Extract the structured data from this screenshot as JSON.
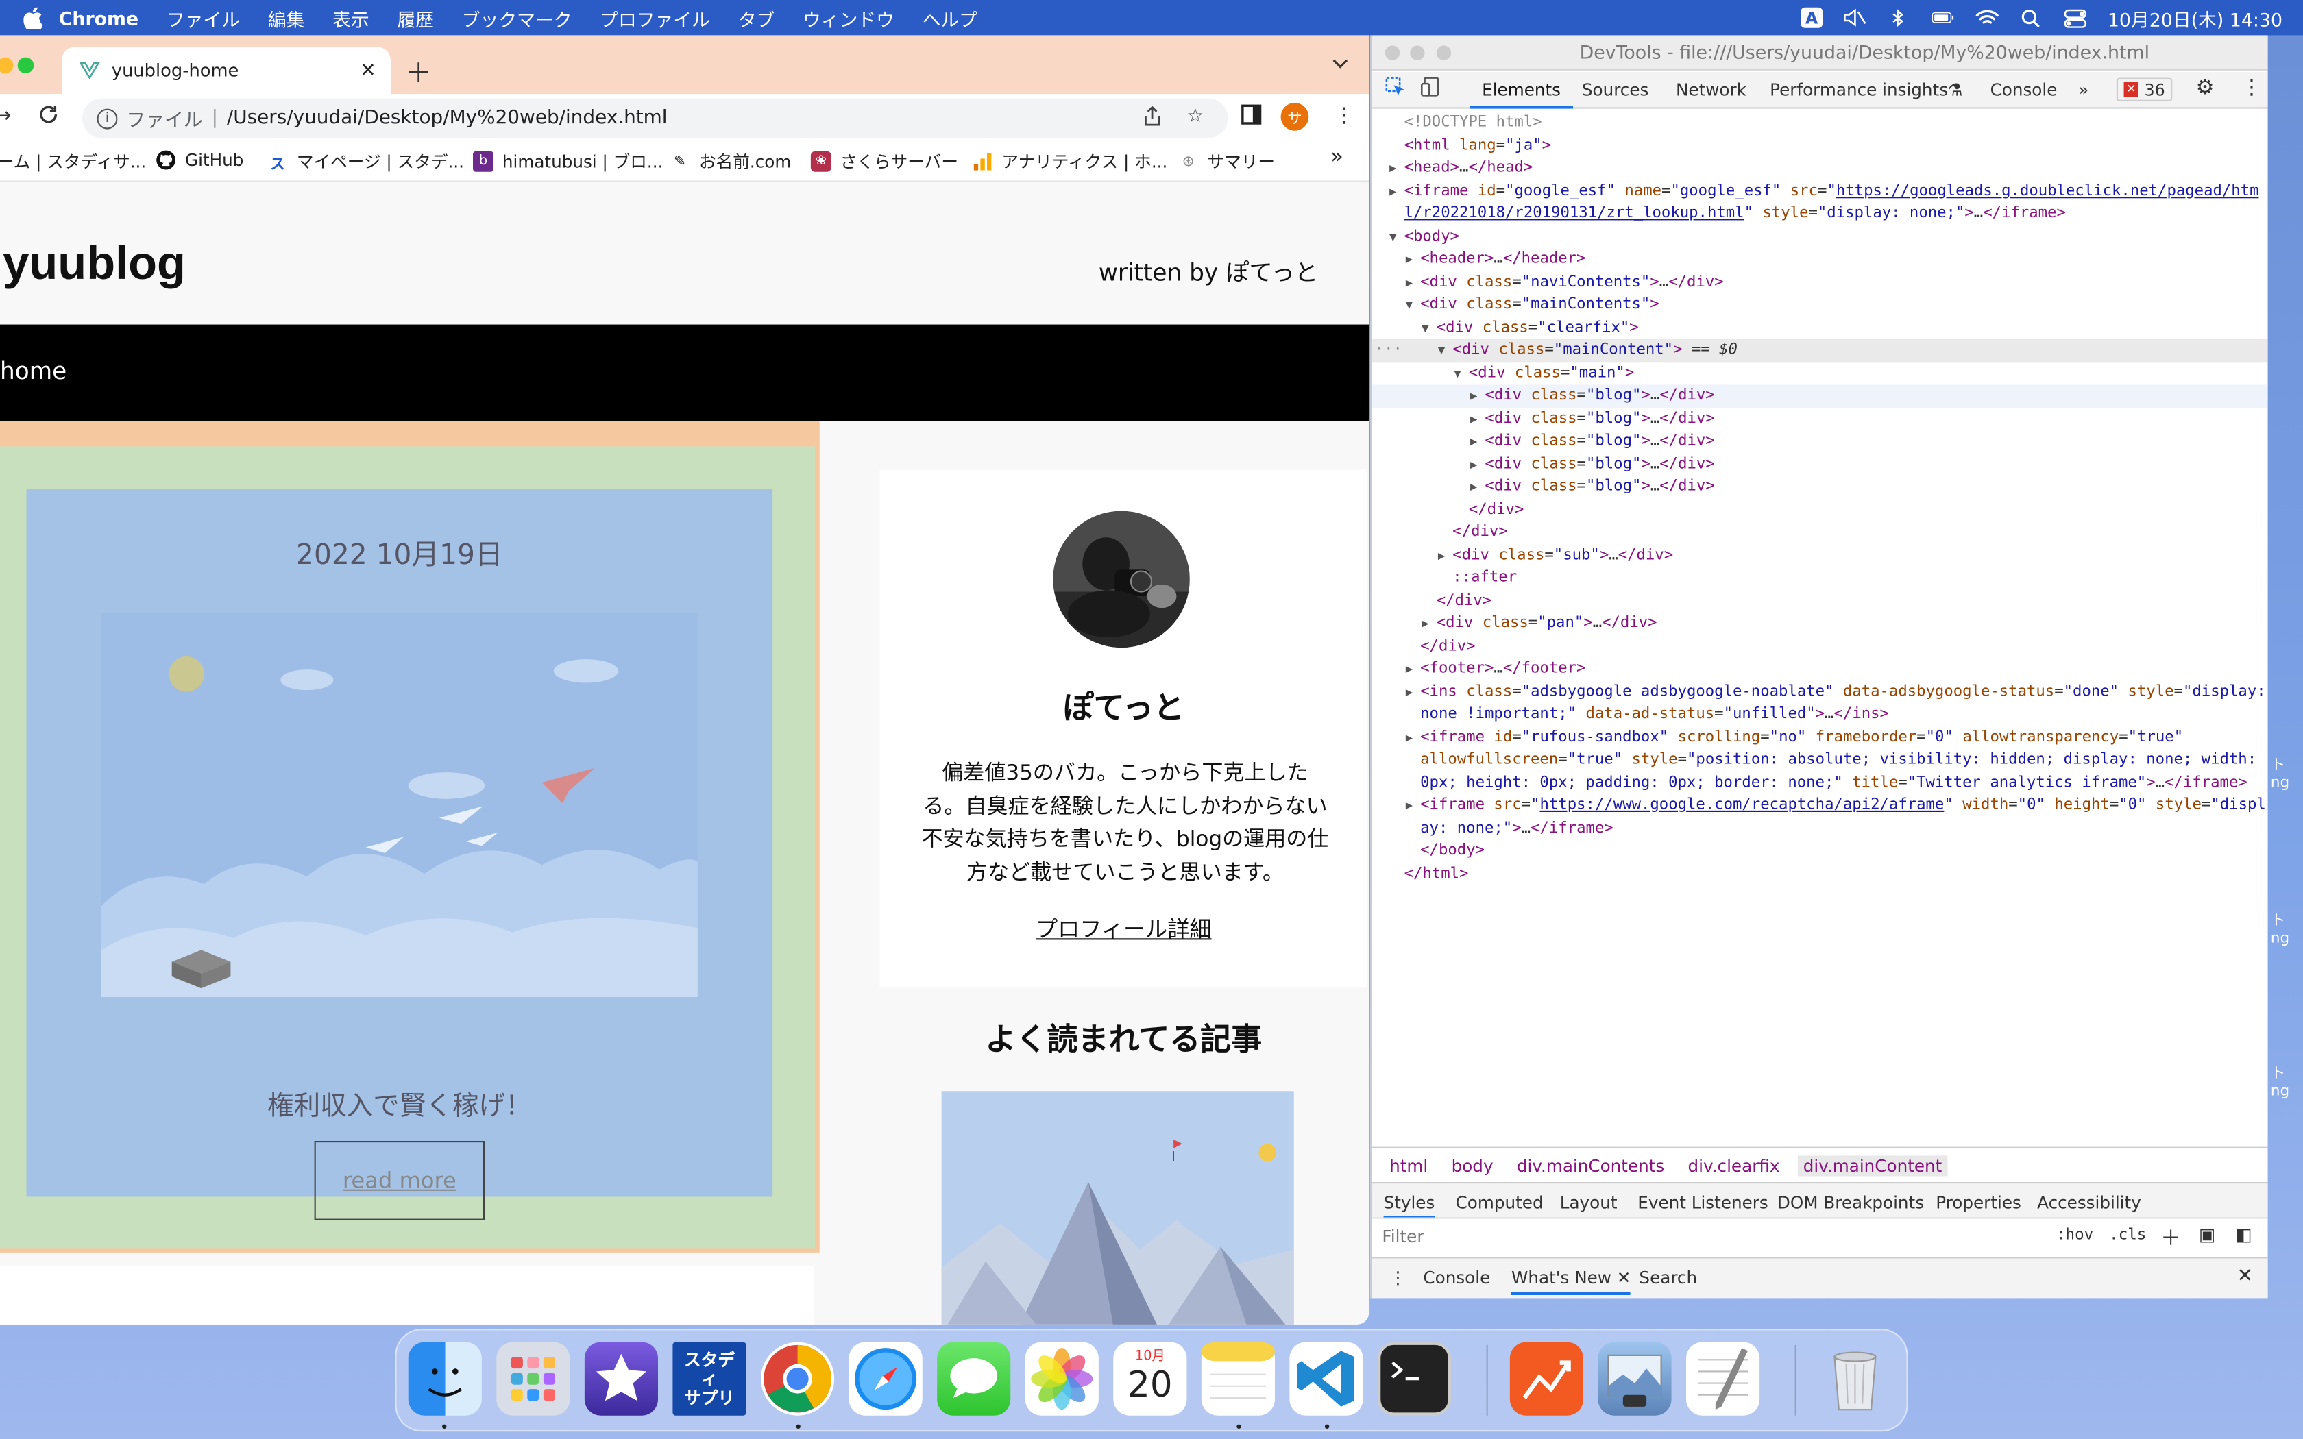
{
  "menubar": {
    "app": "Chrome",
    "items": [
      "ファイル",
      "編集",
      "表示",
      "履歴",
      "ブックマーク",
      "プロファイル",
      "タブ",
      "ウィンドウ",
      "ヘルプ"
    ],
    "input_indicator": "A",
    "datetime": "10月20日(木) 14:30"
  },
  "browser": {
    "tab_title": "yuublog-home",
    "url_scheme": "ファイル",
    "url_path": "/Users/yuudai/Desktop/My%20web/index.html",
    "profile_initial": "サ",
    "bookmarks": [
      {
        "label": "ーム | スタディサ...",
        "icon": "page-icon"
      },
      {
        "label": "GitHub",
        "icon": "github-icon"
      },
      {
        "label": "マイページ | スタデ...",
        "icon": "studysapuri-icon"
      },
      {
        "label": "himatubusi | ブロ...",
        "icon": "blog-icon"
      },
      {
        "label": "お名前.com",
        "icon": "onamae-icon"
      },
      {
        "label": "さくらサーバー",
        "icon": "sakura-icon"
      },
      {
        "label": "アナリティクス | ホ...",
        "icon": "analytics-icon"
      },
      {
        "label": "サマリー",
        "icon": "summary-icon"
      }
    ],
    "bookmarks_more": "»"
  },
  "site": {
    "logo": "yuublog",
    "byline": "written by ぽてっと",
    "nav_home": "home",
    "post": {
      "date": "2022 10月19日",
      "title": "権利収入で賢く稼げ！",
      "read_more": "read more"
    },
    "profile": {
      "name": "ぽてっと",
      "description": "偏差値35のバカ。こっから下克上したる。自臭症を経験した人にしかわからない不安な気持ちを書いたり、blogの運用の仕方など載せていこうと思います。",
      "link": "プロフィール詳細"
    },
    "popular_heading": "よく読まれてる記事"
  },
  "devtools": {
    "title": "DevTools - file:///Users/yuudai/Desktop/My%20web/index.html",
    "tabs": [
      "Elements",
      "Sources",
      "Network",
      "Performance insights",
      "Console"
    ],
    "more": "»",
    "error_count": "36",
    "lines": [
      {
        "indent": 0,
        "html": "<span class='cmt'>&lt;!DOCTYPE html&gt;</span>"
      },
      {
        "indent": 0,
        "html": "<span class='tag'>&lt;html</span> <span class='attr'>lang</span>=<span class='val'>\"ja\"</span><span class='tag'>&gt;</span>"
      },
      {
        "indent": 0,
        "tri": "▶",
        "html": "<span class='tag'>&lt;head&gt;</span>…<span class='tag'>&lt;/head&gt;</span>"
      },
      {
        "indent": 0,
        "tri": "▶",
        "html": "<span class='tag'>&lt;iframe</span> <span class='attr'>id</span>=<span class='val'>\"google_esf\"</span> <span class='attr'>name</span>=<span class='val'>\"google_esf\"</span> <span class='attr'>src</span>=<span class='val'>\"<span class='lnk'>https://googleads.g.doubleclick.net/pagead/htm</span></span>"
      },
      {
        "indent": 0,
        "cont": true,
        "html": "<span class='lnk'>l/r20221018/r20190131/zrt_lookup.html</span><span class='val'>\"</span> <span class='attr'>style</span>=<span class='val'>\"display: none;\"</span><span class='tag'>&gt;</span>…<span class='tag'>&lt;/iframe&gt;</span>"
      },
      {
        "indent": 0,
        "tri": "▼",
        "html": "<span class='tag'>&lt;body&gt;</span>"
      },
      {
        "indent": 1,
        "tri": "▶",
        "html": "<span class='tag'>&lt;header&gt;</span>…<span class='tag'>&lt;/header&gt;</span>"
      },
      {
        "indent": 1,
        "tri": "▶",
        "html": "<span class='tag'>&lt;div</span> <span class='attr'>class</span>=<span class='val'>\"naviContents\"</span><span class='tag'>&gt;</span>…<span class='tag'>&lt;/div&gt;</span>"
      },
      {
        "indent": 1,
        "tri": "▼",
        "html": "<span class='tag'>&lt;div</span> <span class='attr'>class</span>=<span class='val'>\"mainContents\"</span><span class='tag'>&gt;</span>"
      },
      {
        "indent": 2,
        "tri": "▼",
        "html": "<span class='tag'>&lt;div</span> <span class='attr'>class</span>=<span class='val'>\"clearfix\"</span><span class='tag'>&gt;</span>"
      },
      {
        "indent": 3,
        "tri": "▼",
        "sel": true,
        "html": "<span class='tag'>&lt;div</span> <span class='attr'>class</span>=<span class='val'>\"mainContent\"</span><span class='tag'>&gt;</span> == <i>$0</i>"
      },
      {
        "indent": 4,
        "tri": "▼",
        "html": "<span class='tag'>&lt;div</span> <span class='attr'>class</span>=<span class='val'>\"main\"</span><span class='tag'>&gt;</span>"
      },
      {
        "indent": 5,
        "tri": "▶",
        "hov": true,
        "html": "<span class='tag'>&lt;div</span> <span class='attr'>class</span>=<span class='val'>\"blog\"</span><span class='tag'>&gt;</span>…<span class='tag'>&lt;/div&gt;</span>"
      },
      {
        "indent": 5,
        "tri": "▶",
        "html": "<span class='tag'>&lt;div</span> <span class='attr'>class</span>=<span class='val'>\"blog\"</span><span class='tag'>&gt;</span>…<span class='tag'>&lt;/div&gt;</span>"
      },
      {
        "indent": 5,
        "tri": "▶",
        "html": "<span class='tag'>&lt;div</span> <span class='attr'>class</span>=<span class='val'>\"blog\"</span><span class='tag'>&gt;</span>…<span class='tag'>&lt;/div&gt;</span>"
      },
      {
        "indent": 5,
        "tri": "▶",
        "html": "<span class='tag'>&lt;div</span> <span class='attr'>class</span>=<span class='val'>\"blog\"</span><span class='tag'>&gt;</span>…<span class='tag'>&lt;/div&gt;</span>"
      },
      {
        "indent": 5,
        "tri": "▶",
        "html": "<span class='tag'>&lt;div</span> <span class='attr'>class</span>=<span class='val'>\"blog\"</span><span class='tag'>&gt;</span>…<span class='tag'>&lt;/div&gt;</span>"
      },
      {
        "indent": 4,
        "html": "<span class='tag'>&lt;/div&gt;</span>"
      },
      {
        "indent": 3,
        "html": "<span class='tag'>&lt;/div&gt;</span>"
      },
      {
        "indent": 3,
        "tri": "▶",
        "html": "<span class='tag'>&lt;div</span> <span class='attr'>class</span>=<span class='val'>\"sub\"</span><span class='tag'>&gt;</span>…<span class='tag'>&lt;/div&gt;</span>"
      },
      {
        "indent": 3,
        "html": "<span class='tag'>::after</span>"
      },
      {
        "indent": 2,
        "html": "<span class='tag'>&lt;/div&gt;</span>"
      },
      {
        "indent": 2,
        "tri": "▶",
        "html": "<span class='tag'>&lt;div</span> <span class='attr'>class</span>=<span class='val'>\"pan\"</span><span class='tag'>&gt;</span>…<span class='tag'>&lt;/div&gt;</span>"
      },
      {
        "indent": 1,
        "html": "<span class='tag'>&lt;/div&gt;</span>"
      },
      {
        "indent": 1,
        "tri": "▶",
        "html": "<span class='tag'>&lt;footer&gt;</span>…<span class='tag'>&lt;/footer&gt;</span>"
      },
      {
        "indent": 1,
        "tri": "▶",
        "html": "<span class='tag'>&lt;ins</span> <span class='attr'>class</span>=<span class='val'>\"adsbygoogle adsbygoogle-noablate\"</span> <span class='attr'>data-adsbygoogle-status</span>=<span class='val'>\"done\"</span> <span class='attr'>style</span>=<span class='val'>\"display:</span>"
      },
      {
        "indent": 1,
        "cont": true,
        "html": "<span class='val'>none !important;\"</span> <span class='attr'>data-ad-status</span>=<span class='val'>\"unfilled\"</span><span class='tag'>&gt;</span>…<span class='tag'>&lt;/ins&gt;</span>"
      },
      {
        "indent": 1,
        "tri": "▶",
        "html": "<span class='tag'>&lt;iframe</span> <span class='attr'>id</span>=<span class='val'>\"rufous-sandbox\"</span> <span class='attr'>scrolling</span>=<span class='val'>\"no\"</span> <span class='attr'>frameborder</span>=<span class='val'>\"0\"</span> <span class='attr'>allowtransparency</span>=<span class='val'>\"true\"</span>"
      },
      {
        "indent": 1,
        "cont": true,
        "html": "<span class='attr'>allowfullscreen</span>=<span class='val'>\"true\"</span> <span class='attr'>style</span>=<span class='val'>\"position: absolute; visibility: hidden; display: none; width:</span>"
      },
      {
        "indent": 1,
        "cont": true,
        "html": "<span class='val'>0px; height: 0px; padding: 0px; border: none;\"</span> <span class='attr'>title</span>=<span class='val'>\"Twitter analytics iframe\"</span><span class='tag'>&gt;</span>…<span class='tag'>&lt;/iframe&gt;</span>"
      },
      {
        "indent": 1,
        "tri": "▶",
        "html": "<span class='tag'>&lt;iframe</span> <span class='attr'>src</span>=<span class='val'>\"<span class='lnk'>https://www.google.com/recaptcha/api2/aframe</span>\"</span> <span class='attr'>width</span>=<span class='val'>\"0\"</span> <span class='attr'>height</span>=<span class='val'>\"0\"</span> <span class='attr'>style</span>=<span class='val'>\"displ</span>"
      },
      {
        "indent": 1,
        "cont": true,
        "html": "<span class='val'>ay: none;\"</span><span class='tag'>&gt;</span>…<span class='tag'>&lt;/iframe&gt;</span>"
      },
      {
        "indent": 1,
        "html": "<span class='tag'>&lt;/body&gt;</span>"
      },
      {
        "indent": 0,
        "html": "<span class='tag'>&lt;/html&gt;</span>"
      }
    ],
    "breadcrumbs": [
      "html",
      "body",
      "div.mainContents",
      "div.clearfix",
      "div.mainContent"
    ],
    "style_tabs": [
      "Styles",
      "Computed",
      "Layout",
      "Event Listeners",
      "DOM Breakpoints",
      "Properties",
      "Accessibility"
    ],
    "filter_placeholder": "Filter",
    "hov": ":hov",
    "cls": ".cls",
    "drawer_tabs": [
      "Console",
      "What's New",
      "Search"
    ]
  },
  "dock": {
    "apps": [
      "finder-icon",
      "launchpad-icon",
      "imovie-icon",
      "studysapuri-icon",
      "chrome-icon",
      "safari-icon",
      "messages-icon",
      "photos-icon",
      "calendar-icon",
      "notes-icon",
      "vscode-icon",
      "terminal-icon",
      "sourcetree-icon",
      "preview-icon",
      "textedit-icon",
      "trash-icon"
    ],
    "studysapuri_label": "スタディ サプリ",
    "calendar_month": "10月",
    "calendar_day": "20"
  },
  "side_fragments": [
    "ト\nng",
    "ト\nng",
    "ト\nng"
  ]
}
